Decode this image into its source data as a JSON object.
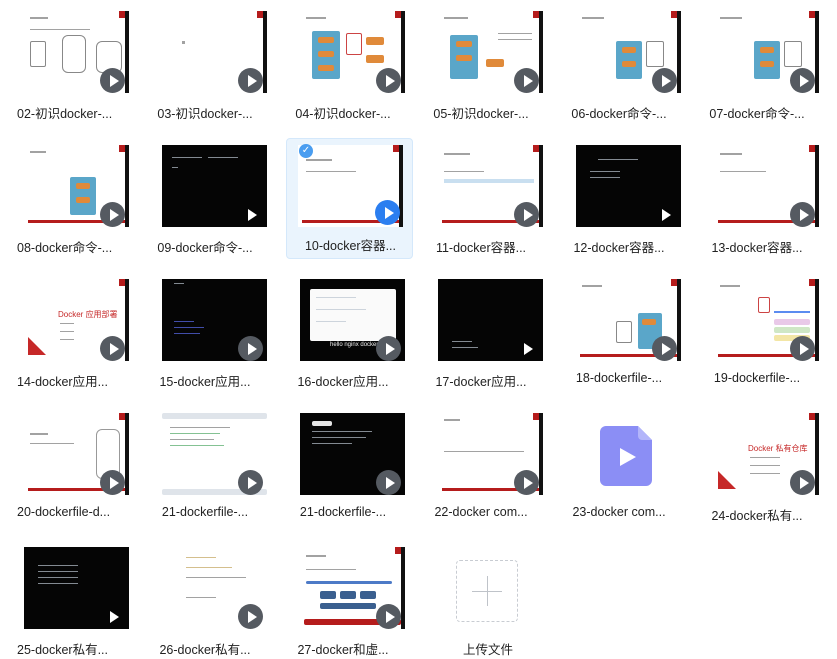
{
  "files": [
    {
      "label": "02-初识docker-..."
    },
    {
      "label": "03-初识docker-..."
    },
    {
      "label": "04-初识docker-..."
    },
    {
      "label": "05-初识docker-..."
    },
    {
      "label": "06-docker命令-..."
    },
    {
      "label": "07-docker命令-..."
    },
    {
      "label": "08-docker命令-..."
    },
    {
      "label": "09-docker命令-..."
    },
    {
      "label": "10-docker容器..."
    },
    {
      "label": "11-docker容器..."
    },
    {
      "label": "12-docker容器..."
    },
    {
      "label": "13-docker容器..."
    },
    {
      "label": "14-docker应用..."
    },
    {
      "label": "15-docker应用..."
    },
    {
      "label": "16-docker应用..."
    },
    {
      "label": "17-docker应用..."
    },
    {
      "label": "18-dockerfile-..."
    },
    {
      "label": "19-dockerfile-..."
    },
    {
      "label": "20-dockerfile-d..."
    },
    {
      "label": "21-dockerfile-..."
    },
    {
      "label": "21-dockerfile-..."
    },
    {
      "label": "22-docker com..."
    },
    {
      "label": "23-docker com..."
    },
    {
      "label": "24-docker私有..."
    },
    {
      "label": "25-docker私有..."
    },
    {
      "label": "26-docker私有..."
    },
    {
      "label": "27-docker和虚..."
    }
  ],
  "thumb_text": {
    "app_deploy": "Docker 应用部署",
    "private_repo": "Docker 私有仓库",
    "hello": "hello nginx docker"
  },
  "upload": {
    "label": "上传文件"
  },
  "colors": {
    "accent": "#2b7ef0",
    "selected_bg": "#eaf4fd",
    "slide_red": "#b51c1c",
    "video_icon": "#8b8ef5"
  },
  "icons": {
    "play": "play-icon",
    "check": "check-icon",
    "video_file": "video-file-icon",
    "plus": "plus-icon"
  }
}
